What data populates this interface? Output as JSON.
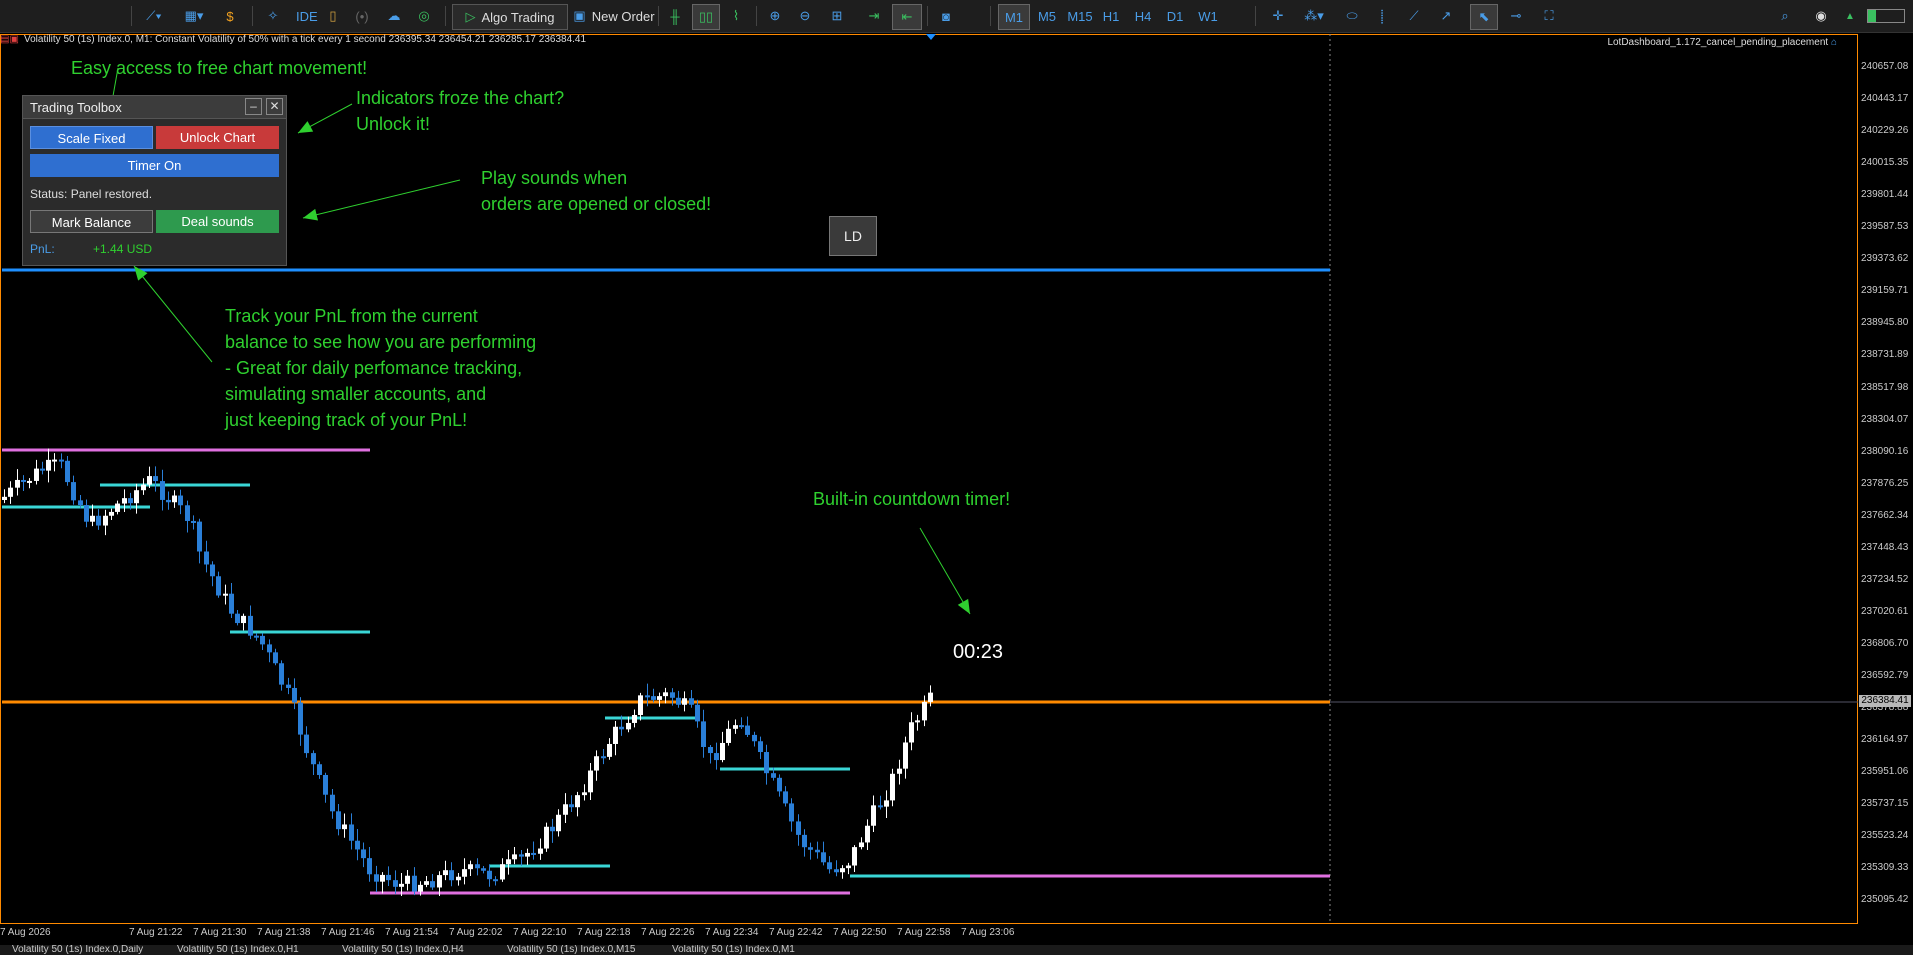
{
  "toolbar": {
    "algo_trading": "Algo Trading",
    "new_order": "New Order",
    "ide": "IDE",
    "timeframes": [
      "M1",
      "M5",
      "M15",
      "H1",
      "H4",
      "D1",
      "W1"
    ],
    "active_timeframe": "M1"
  },
  "chart": {
    "info": "Volatility 50 (1s) Index.0, M1:  Constant Volatility of 50% with a tick every 1 second  236395.34 236454.21 236285.17 236384.41",
    "ea_label": "LotDashboard_1.172_cancel_pending_placement",
    "current_price": "236384.41",
    "price_ticks": [
      "240657.08",
      "240443.17",
      "240229.26",
      "240015.35",
      "239801.44",
      "239587.53",
      "239373.62",
      "239159.71",
      "238945.80",
      "238731.89",
      "238517.98",
      "238304.07",
      "238090.16",
      "237876.25",
      "237662.34",
      "237448.43",
      "237234.52",
      "237020.61",
      "236806.70",
      "236592.79",
      "236378.88",
      "236164.97",
      "235951.06",
      "235737.15",
      "235523.24",
      "235309.33",
      "235095.42"
    ],
    "time_ticks": [
      "7 Aug 2026",
      "7 Aug 21:22",
      "7 Aug 21:30",
      "7 Aug 21:38",
      "7 Aug 21:46",
      "7 Aug 21:54",
      "7 Aug 22:02",
      "7 Aug 22:10",
      "7 Aug 22:18",
      "7 Aug 22:26",
      "7 Aug 22:34",
      "7 Aug 22:42",
      "7 Aug 22:50",
      "7 Aug 22:58",
      "7 Aug 23:06"
    ]
  },
  "panel": {
    "title": "Trading Toolbox",
    "scale_fixed": "Scale Fixed",
    "unlock_chart": "Unlock Chart",
    "timer_on": "Timer On",
    "status": "Status: Panel restored.",
    "mark_balance": "Mark Balance",
    "deal_sounds": "Deal sounds",
    "pnl_label": "PnL:",
    "pnl_value": "+1.44 USD"
  },
  "ld_button": "LD",
  "timer": "00:23",
  "annotations": {
    "free_move": "Easy access to free chart movement!",
    "unlock_1": "Indicators froze the chart?",
    "unlock_2": "Unlock it!",
    "sounds_1": "Play sounds when",
    "sounds_2": "orders are opened or closed!",
    "pnl_1": "Track your PnL from the current",
    "pnl_2": "balance to see how you are performing",
    "pnl_3": "- Great for daily perfomance tracking,",
    "pnl_4": "simulating smaller accounts, and",
    "pnl_5": "just keeping track of your PnL!",
    "timer": "Built-in countdown timer!"
  },
  "bottom_tabs": [
    "Volatility 50 (1s) Index.0,Daily",
    "Volatility 50 (1s) Index.0,H1",
    "Volatility 50 (1s) Index.0,H4",
    "Volatility 50 (1s) Index.0,M15",
    "Volatility 50 (1s) Index.0,M1"
  ],
  "colors": {
    "annotation": "#2fd02f",
    "balance_line": "#1e8fff",
    "price_line": "#ff8a00",
    "level_cyan": "#3ad6d6",
    "level_magenta": "#e070e0",
    "bull": "#ffffff",
    "bear": "#2a7fd8"
  }
}
